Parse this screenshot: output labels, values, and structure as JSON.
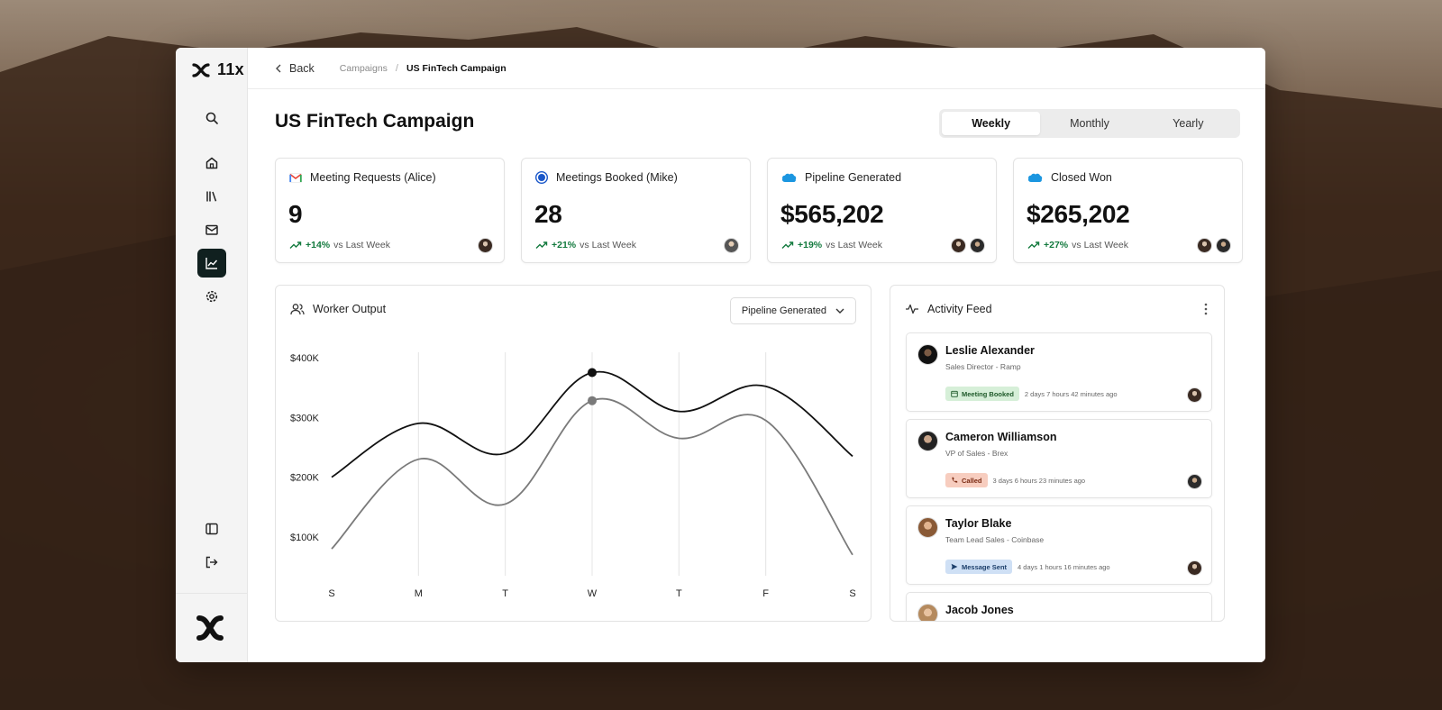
{
  "app": {
    "logo_text": "11x"
  },
  "breadcrumb": {
    "back_label": "Back",
    "parent": "Campaigns",
    "separator": "/",
    "current": "US FinTech Campaign"
  },
  "page": {
    "title": "US FinTech Campaign"
  },
  "period_tabs": [
    {
      "label": "Weekly",
      "active": true
    },
    {
      "label": "Monthly",
      "active": false
    },
    {
      "label": "Yearly",
      "active": false
    }
  ],
  "kpis": [
    {
      "title": "Meeting Requests (Alice)",
      "icon": "gmail-icon",
      "value": "9",
      "change": "+14%",
      "suffix": "vs Last Week",
      "avatars": 1
    },
    {
      "title": "Meetings Booked (Mike)",
      "icon": "blue-circle-icon",
      "value": "28",
      "change": "+21%",
      "suffix": "vs Last Week",
      "avatars": 1
    },
    {
      "title": "Pipeline Generated",
      "icon": "salesforce-icon",
      "value": "$565,202",
      "change": "+19%",
      "suffix": "vs Last Week",
      "avatars": 2
    },
    {
      "title": "Closed Won",
      "icon": "salesforce-icon",
      "value": "$265,202",
      "change": "+27%",
      "suffix": "vs Last Week",
      "avatars": 2
    }
  ],
  "worker_output": {
    "title": "Worker Output",
    "dropdown_value": "Pipeline Generated"
  },
  "chart_data": {
    "type": "line",
    "categories": [
      "S",
      "M",
      "T",
      "W",
      "T",
      "F",
      "S"
    ],
    "series": [
      {
        "values": [
          200000,
          290000,
          240000,
          375000,
          310000,
          352000,
          235000
        ],
        "color": "#111111",
        "highlight_index": 3
      },
      {
        "values": [
          80000,
          230000,
          155000,
          328000,
          265000,
          295000,
          70000
        ],
        "color": "#7a7a7a",
        "highlight_index": 3
      }
    ],
    "yticks": [
      {
        "value": 100000,
        "label": "$100K"
      },
      {
        "value": 200000,
        "label": "$200K"
      },
      {
        "value": 300000,
        "label": "$300K"
      },
      {
        "value": 400000,
        "label": "$400K"
      }
    ],
    "ylim": [
      35000,
      415000
    ],
    "grid": "vertical"
  },
  "activity_feed": {
    "title": "Activity Feed",
    "items": [
      {
        "name": "Leslie Alexander",
        "role": "Sales Director - Ramp",
        "badge": "Meeting Booked",
        "badge_color": "green",
        "time": "2 days 7 hours 42 minutes ago"
      },
      {
        "name": "Cameron Williamson",
        "role": "VP of Sales - Brex",
        "badge": "Called",
        "badge_color": "orange",
        "time": "3 days 6 hours 23 minutes ago"
      },
      {
        "name": "Taylor Blake",
        "role": "Team Lead Sales - Coinbase",
        "badge": "Message Sent",
        "badge_color": "blue",
        "time": "4 days 1 hours 16 minutes ago"
      },
      {
        "name": "Jacob Jones",
        "role": "",
        "badge": "",
        "badge_color": "",
        "time": ""
      }
    ]
  }
}
